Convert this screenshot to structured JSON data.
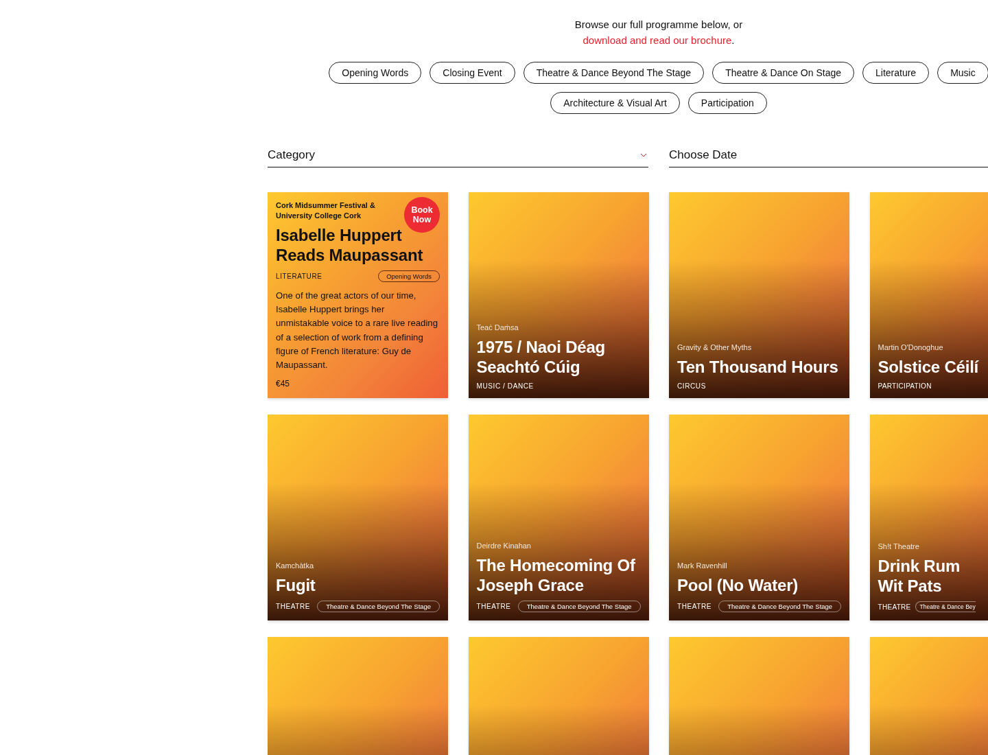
{
  "intro": {
    "text": "Browse our full programme below, or",
    "link": "download and read our brochure",
    "after": "."
  },
  "filters": [
    {
      "label": "Opening Words"
    },
    {
      "label": "Closing Event"
    },
    {
      "label": "Theatre & Dance Beyond The Stage"
    },
    {
      "label": "Theatre & Dance On Stage"
    },
    {
      "label": "Literature"
    },
    {
      "label": "Music"
    },
    {
      "label": "Architecture & Visual Art"
    },
    {
      "label": "Participation"
    }
  ],
  "selects": [
    {
      "label": "Category",
      "kind": "dropdown"
    },
    {
      "label": "Choose Date",
      "kind": "date"
    }
  ],
  "cards": [
    {
      "kind": "featured",
      "presenter": "Cork Midsummer Festival & University College Cork",
      "title": "Isabelle Huppert Reads Maupassant",
      "category": "LITERATURE",
      "tag": "Opening Words",
      "description": "One of the great actors of our time, Isabelle Huppert brings her unmistakable voice to a rare live reading of a selection of work from a defining figure of French literature: Guy de Maupassant.",
      "price": "€45",
      "book": "Book Now"
    },
    {
      "kind": "event",
      "presenter": "Teaċ Daṁsa",
      "title": "1975 / Naoi Déag Seachtó Cúig",
      "category": "MUSIC / DANCE"
    },
    {
      "kind": "event",
      "presenter": "Gravity & Other Myths",
      "title": "Ten Thousand Hours",
      "category": "CIRCUS"
    },
    {
      "kind": "event",
      "presenter": "Martin O'Donoghue",
      "title": "Solstice Céilí",
      "category": "PARTICIPATION"
    },
    {
      "kind": "event",
      "presenter": "Kamchàtka",
      "title": "Fugit",
      "category": "THEATRE",
      "tag": "Theatre & Dance Beyond The Stage"
    },
    {
      "kind": "event",
      "presenter": "Deirdre Kinahan",
      "title": "The Homecoming Of Joseph Grace",
      "category": "THEATRE",
      "tag": "Theatre & Dance Beyond The Stage"
    },
    {
      "kind": "event",
      "presenter": "Mark Ravenhill",
      "title": "Pool (No Water)",
      "category": "THEATRE",
      "tag": "Theatre & Dance Beyond The Stage"
    },
    {
      "kind": "event",
      "presenter": "Sh!t Theatre",
      "title": "Drink Rum Wit Pats",
      "category": "THEATRE",
      "tag": "Theatre & Dance Bey"
    },
    {
      "kind": "blank"
    },
    {
      "kind": "blank"
    },
    {
      "kind": "blank"
    },
    {
      "kind": "blank"
    }
  ]
}
